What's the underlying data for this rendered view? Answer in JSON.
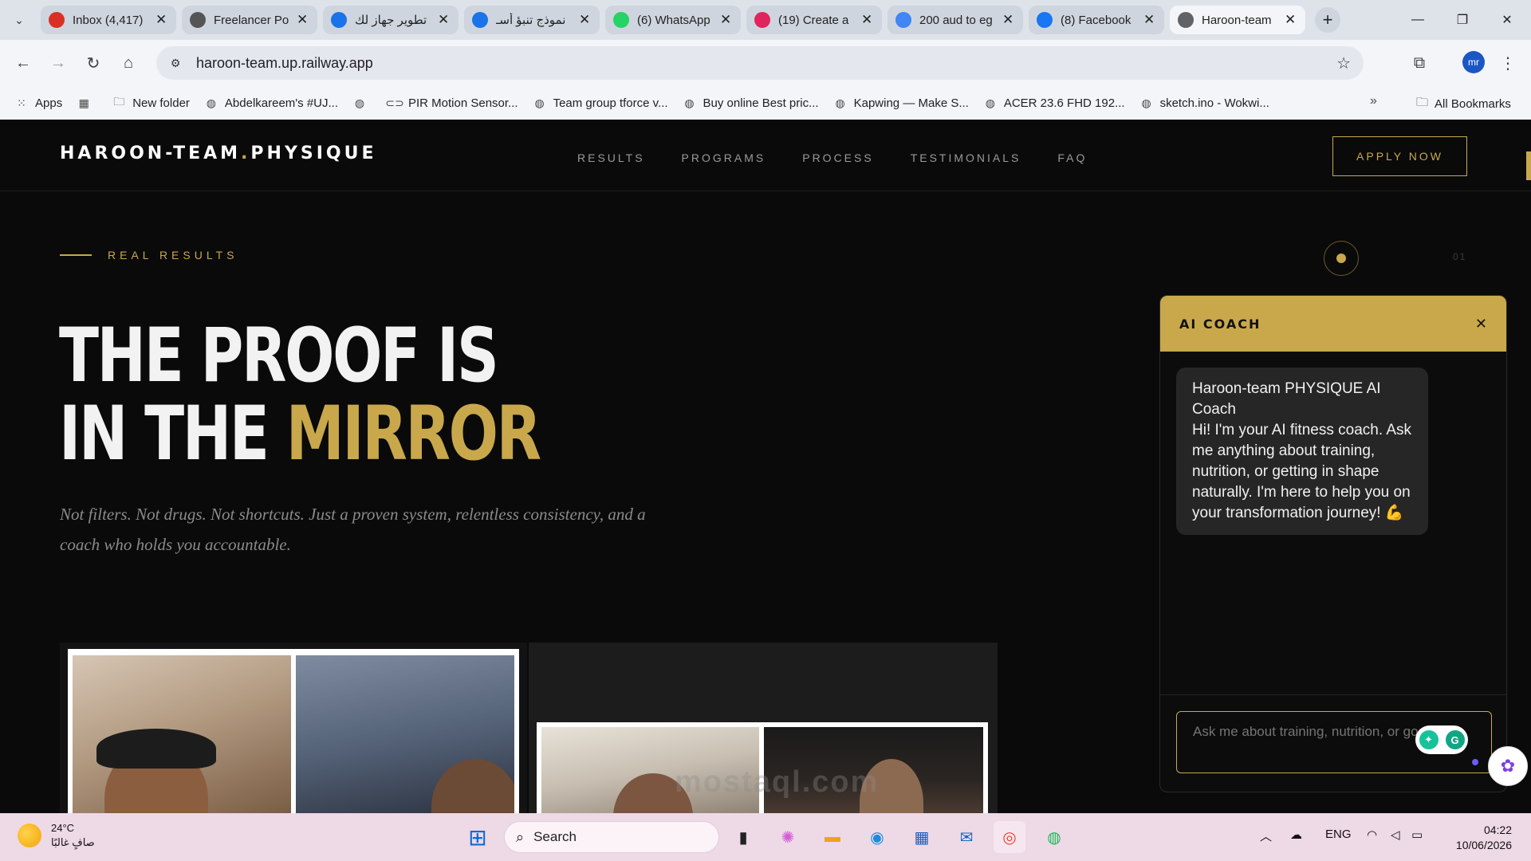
{
  "browser": {
    "tabs": [
      {
        "title": "Inbox (4,417)",
        "icon": "gmail-icon",
        "color": "#d93025",
        "active": false
      },
      {
        "title": "Freelancer Po",
        "icon": "openai-icon",
        "color": "#555555",
        "active": false
      },
      {
        "title": "تطوير جهاز لك",
        "icon": "circle-app-icon",
        "color": "#1a73e8",
        "active": false
      },
      {
        "title": "نموذج تنبؤ أسـ",
        "icon": "circle-app-icon",
        "color": "#1a73e8",
        "active": false
      },
      {
        "title": "(6) WhatsApp",
        "icon": "whatsapp-icon",
        "color": "#25d366",
        "active": false
      },
      {
        "title": "(19) Create a",
        "icon": "bird-icon",
        "color": "#e0245e",
        "active": false
      },
      {
        "title": "200 aud to eg",
        "icon": "google-icon",
        "color": "#4285f4",
        "active": false
      },
      {
        "title": "(8) Facebook",
        "icon": "facebook-icon",
        "color": "#1877f2",
        "active": false
      },
      {
        "title": "Haroon-team",
        "icon": "globe-icon",
        "color": "#5f6368",
        "active": true
      }
    ],
    "url": "haroon-team.up.railway.app",
    "profile_initials": "mr",
    "bookmarks": [
      {
        "label": "Apps",
        "icon": "apps-grid-icon"
      },
      {
        "label": "",
        "icon": "grid-icon"
      },
      {
        "label": "New folder",
        "icon": "folder-icon"
      },
      {
        "label": "Abdelkareem's #UJ...",
        "icon": "globe-icon"
      },
      {
        "label": "",
        "icon": "globe-icon"
      },
      {
        "label": "PIR Motion Sensor...",
        "icon": "link-icon"
      },
      {
        "label": "Team group tforce v...",
        "icon": "globe-icon"
      },
      {
        "label": "Buy online Best pric...",
        "icon": "globe-icon"
      },
      {
        "label": "Kapwing — Make S...",
        "icon": "globe-icon"
      },
      {
        "label": "ACER 23.6 FHD 192...",
        "icon": "globe-icon"
      },
      {
        "label": "sketch.ino - Wokwi...",
        "icon": "globe-icon"
      }
    ],
    "all_bookmarks": "All Bookmarks"
  },
  "site": {
    "logo_part1": "HAROON-TEAM",
    "logo_dot": ".",
    "logo_part2": "PHYSIQUE",
    "nav": [
      "RESULTS",
      "PROGRAMS",
      "PROCESS",
      "TESTIMONIALS",
      "FAQ"
    ],
    "apply": "APPLY NOW",
    "eyebrow": "REAL RESULTS",
    "title_line1": "THE PROOF IS",
    "title_line2_plain": "IN THE ",
    "title_line2_gold": "MIRROR",
    "subtitle": "Not filters. Not drugs. Not shortcuts. Just a proven system, relentless consistency, and a coach who holds you accountable.",
    "slide_number": "01",
    "accent_color": "#c9a84c"
  },
  "chat": {
    "title": "AI COACH",
    "close": "✕",
    "greeting_title": "Haroon-team PHYSIQUE AI Coach",
    "greeting_body": "Hi! I'm your AI fitness coach. Ask me anything about training, nutrition, or getting in shape naturally. I'm here to help you on your transformation journey! 💪",
    "input_placeholder": "Ask me about training, nutrition, or goals..."
  },
  "taskbar": {
    "temperature": "24°C",
    "weather_text": "صافٍ غالبًا",
    "search_label": "Search",
    "language": "ENG",
    "time": "04:22",
    "date": "10/06/2026"
  },
  "watermark": "mostaql.com"
}
